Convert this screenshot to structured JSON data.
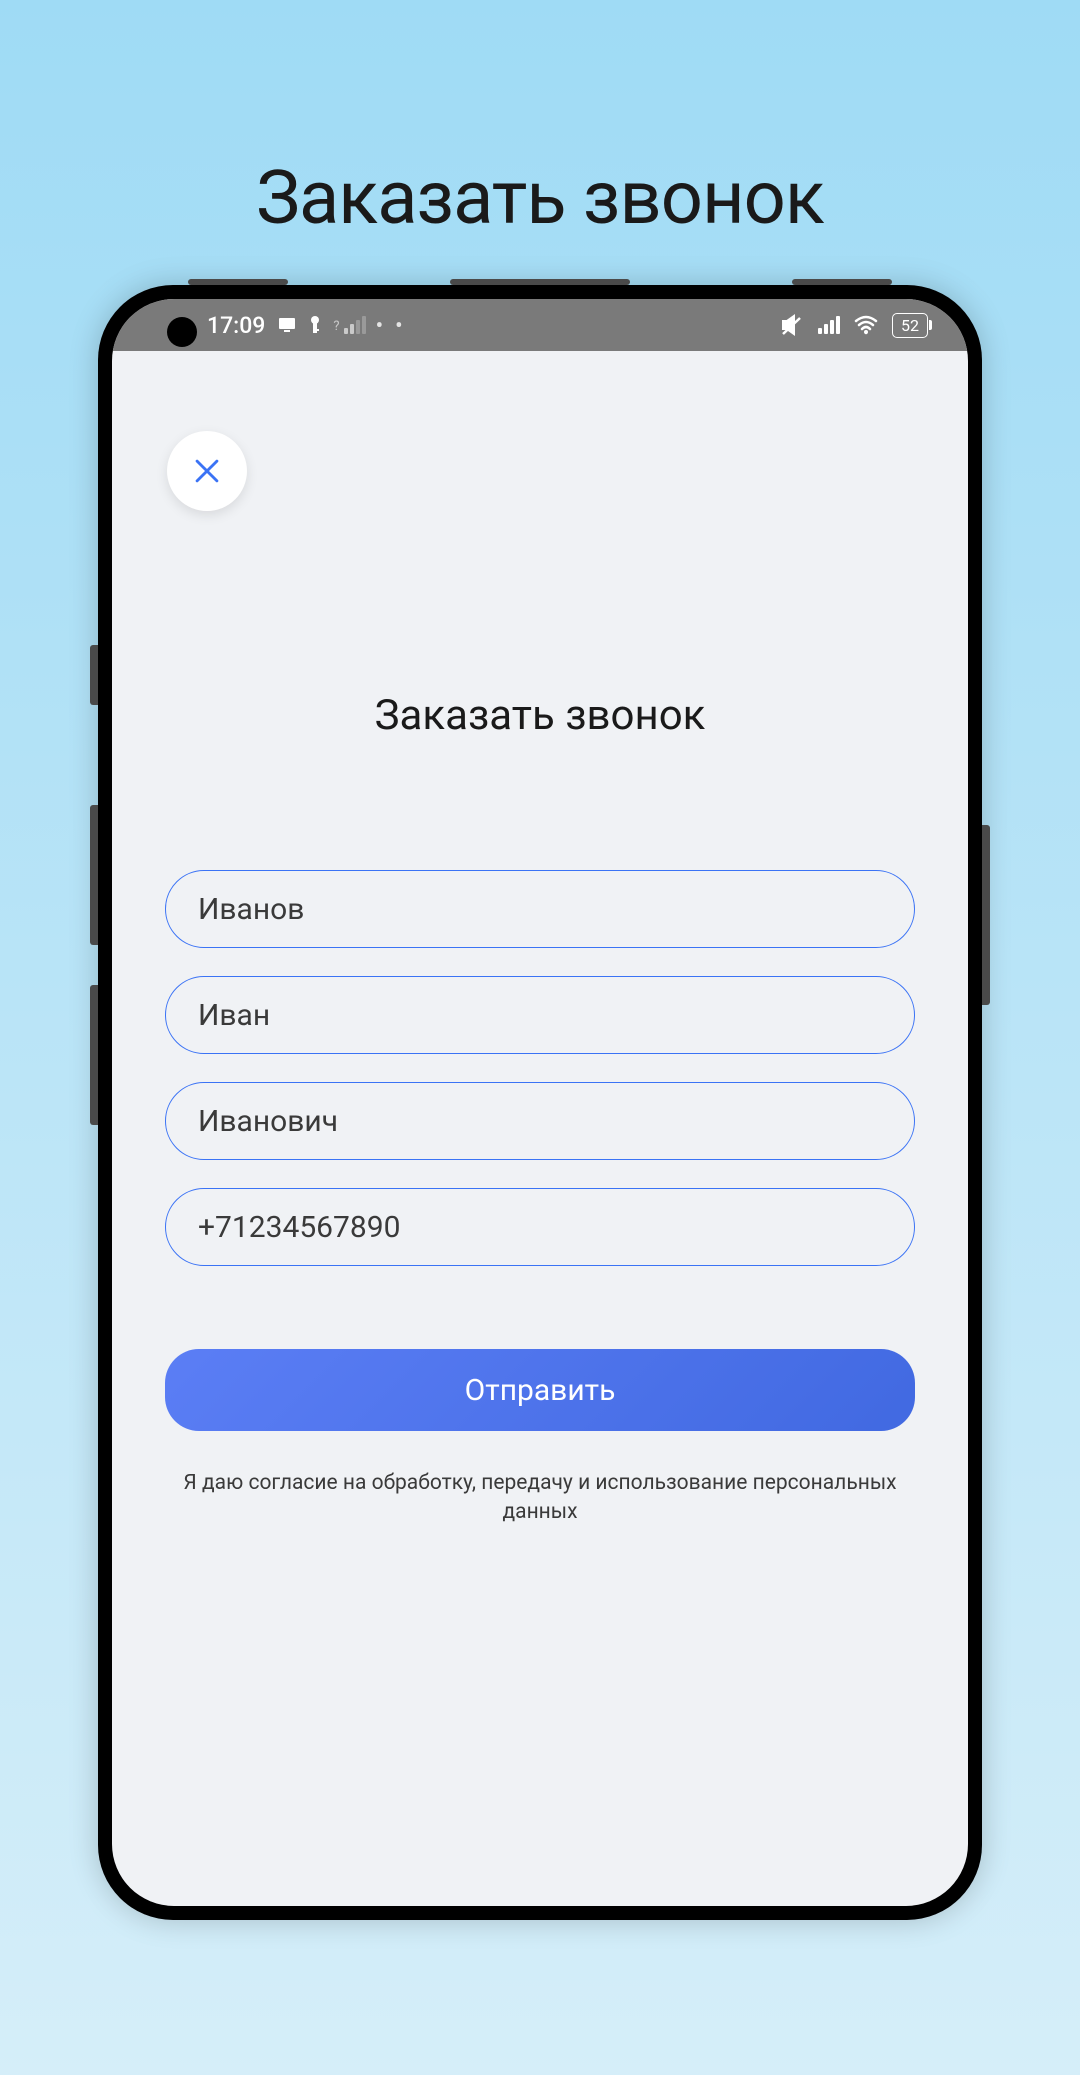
{
  "page": {
    "title": "Заказать звонок"
  },
  "statusBar": {
    "time": "17:09",
    "battery": "52"
  },
  "form": {
    "title": "Заказать звонок",
    "fields": {
      "lastName": "Иванов",
      "firstName": "Иван",
      "patronymic": "Иванович",
      "phone": "+71234567890"
    },
    "submitLabel": "Отправить",
    "consentText": "Я даю согласие на обработку, передачу и использование персональных данных"
  }
}
